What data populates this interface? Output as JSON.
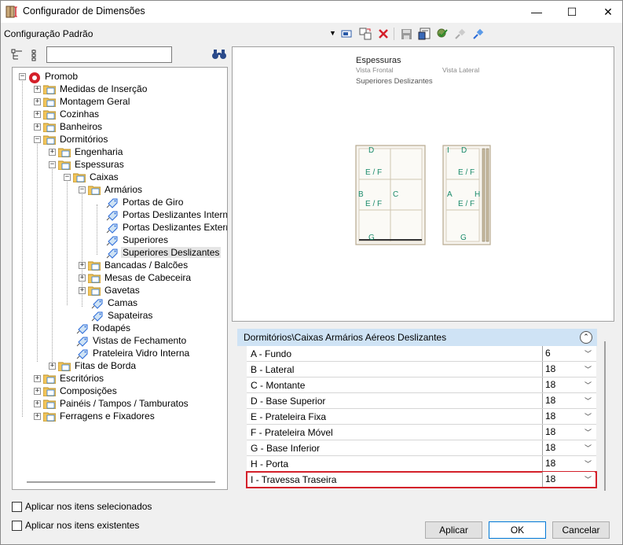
{
  "window": {
    "title": "Configurador de Dimensões",
    "minimize_glyph": "—",
    "maximize_glyph": "☐",
    "close_glyph": "✕"
  },
  "config": {
    "name": "Configuração Padrão",
    "toolbar_icons": [
      "rename-icon",
      "copy-config-icon",
      "delete-icon",
      "save-icon",
      "import-icon",
      "apply-icon",
      "connect-icon",
      "edit-icon"
    ]
  },
  "tree": {
    "search_placeholder": "",
    "items": [
      {
        "label": "Promob"
      },
      {
        "label": "Medidas de Inserção"
      },
      {
        "label": "Montagem Geral"
      },
      {
        "label": "Cozinhas"
      },
      {
        "label": "Banheiros"
      },
      {
        "label": "Dormitórios"
      },
      {
        "label": "Engenharia"
      },
      {
        "label": "Espessuras"
      },
      {
        "label": "Caixas"
      },
      {
        "label": "Armários"
      },
      {
        "label": "Portas de Giro"
      },
      {
        "label": "Portas Deslizantes Internas"
      },
      {
        "label": "Portas Deslizantes Externas"
      },
      {
        "label": "Superiores"
      },
      {
        "label": "Superiores Deslizantes"
      },
      {
        "label": "Bancadas / Balcões"
      },
      {
        "label": "Mesas de Cabeceira"
      },
      {
        "label": "Gavetas"
      },
      {
        "label": "Camas"
      },
      {
        "label": "Sapateiras"
      },
      {
        "label": "Rodapés"
      },
      {
        "label": "Vistas de Fechamento"
      },
      {
        "label": "Prateleira Vidro Interna"
      },
      {
        "label": "Fitas de Borda"
      },
      {
        "label": "Escritórios"
      },
      {
        "label": "Composições"
      },
      {
        "label": "Painéis / Tampos / Tamburatos"
      },
      {
        "label": "Ferragens e Fixadores"
      }
    ]
  },
  "options": {
    "apply_selected": "Aplicar nos itens selecionados",
    "apply_existing": "Aplicar nos itens existentes"
  },
  "preview": {
    "title": "Espessuras",
    "front_label": "Vista Frontal",
    "side_label": "Vista Lateral",
    "name": "Superiores Deslizantes",
    "front_marks": [
      "D",
      "E / F",
      "B",
      "C",
      "E / F",
      "G"
    ],
    "side_marks": [
      "I",
      "D",
      "E / F",
      "A",
      "H",
      "E / F",
      "G"
    ]
  },
  "properties": {
    "header": "Dormitórios\\Caixas Armários Aéreos Deslizantes",
    "rows": [
      {
        "label": "A - Fundo",
        "value": "6"
      },
      {
        "label": "B - Lateral",
        "value": "18"
      },
      {
        "label": "C - Montante",
        "value": "18"
      },
      {
        "label": "D - Base Superior",
        "value": "18"
      },
      {
        "label": "E - Prateleira Fixa",
        "value": "18"
      },
      {
        "label": "F - Prateleira Móvel",
        "value": "18"
      },
      {
        "label": "G - Base Inferior",
        "value": "18"
      },
      {
        "label": "H - Porta",
        "value": "18"
      },
      {
        "label": "I - Travessa Traseira",
        "value": "18"
      }
    ]
  },
  "buttons": {
    "apply": "Aplicar",
    "ok": "OK",
    "cancel": "Cancelar"
  },
  "colors": {
    "accent": "#0078d7",
    "highlight_border": "#d4202a",
    "header_bg": "#cfe3f5",
    "dimension_mark": "#1a8a6a"
  }
}
